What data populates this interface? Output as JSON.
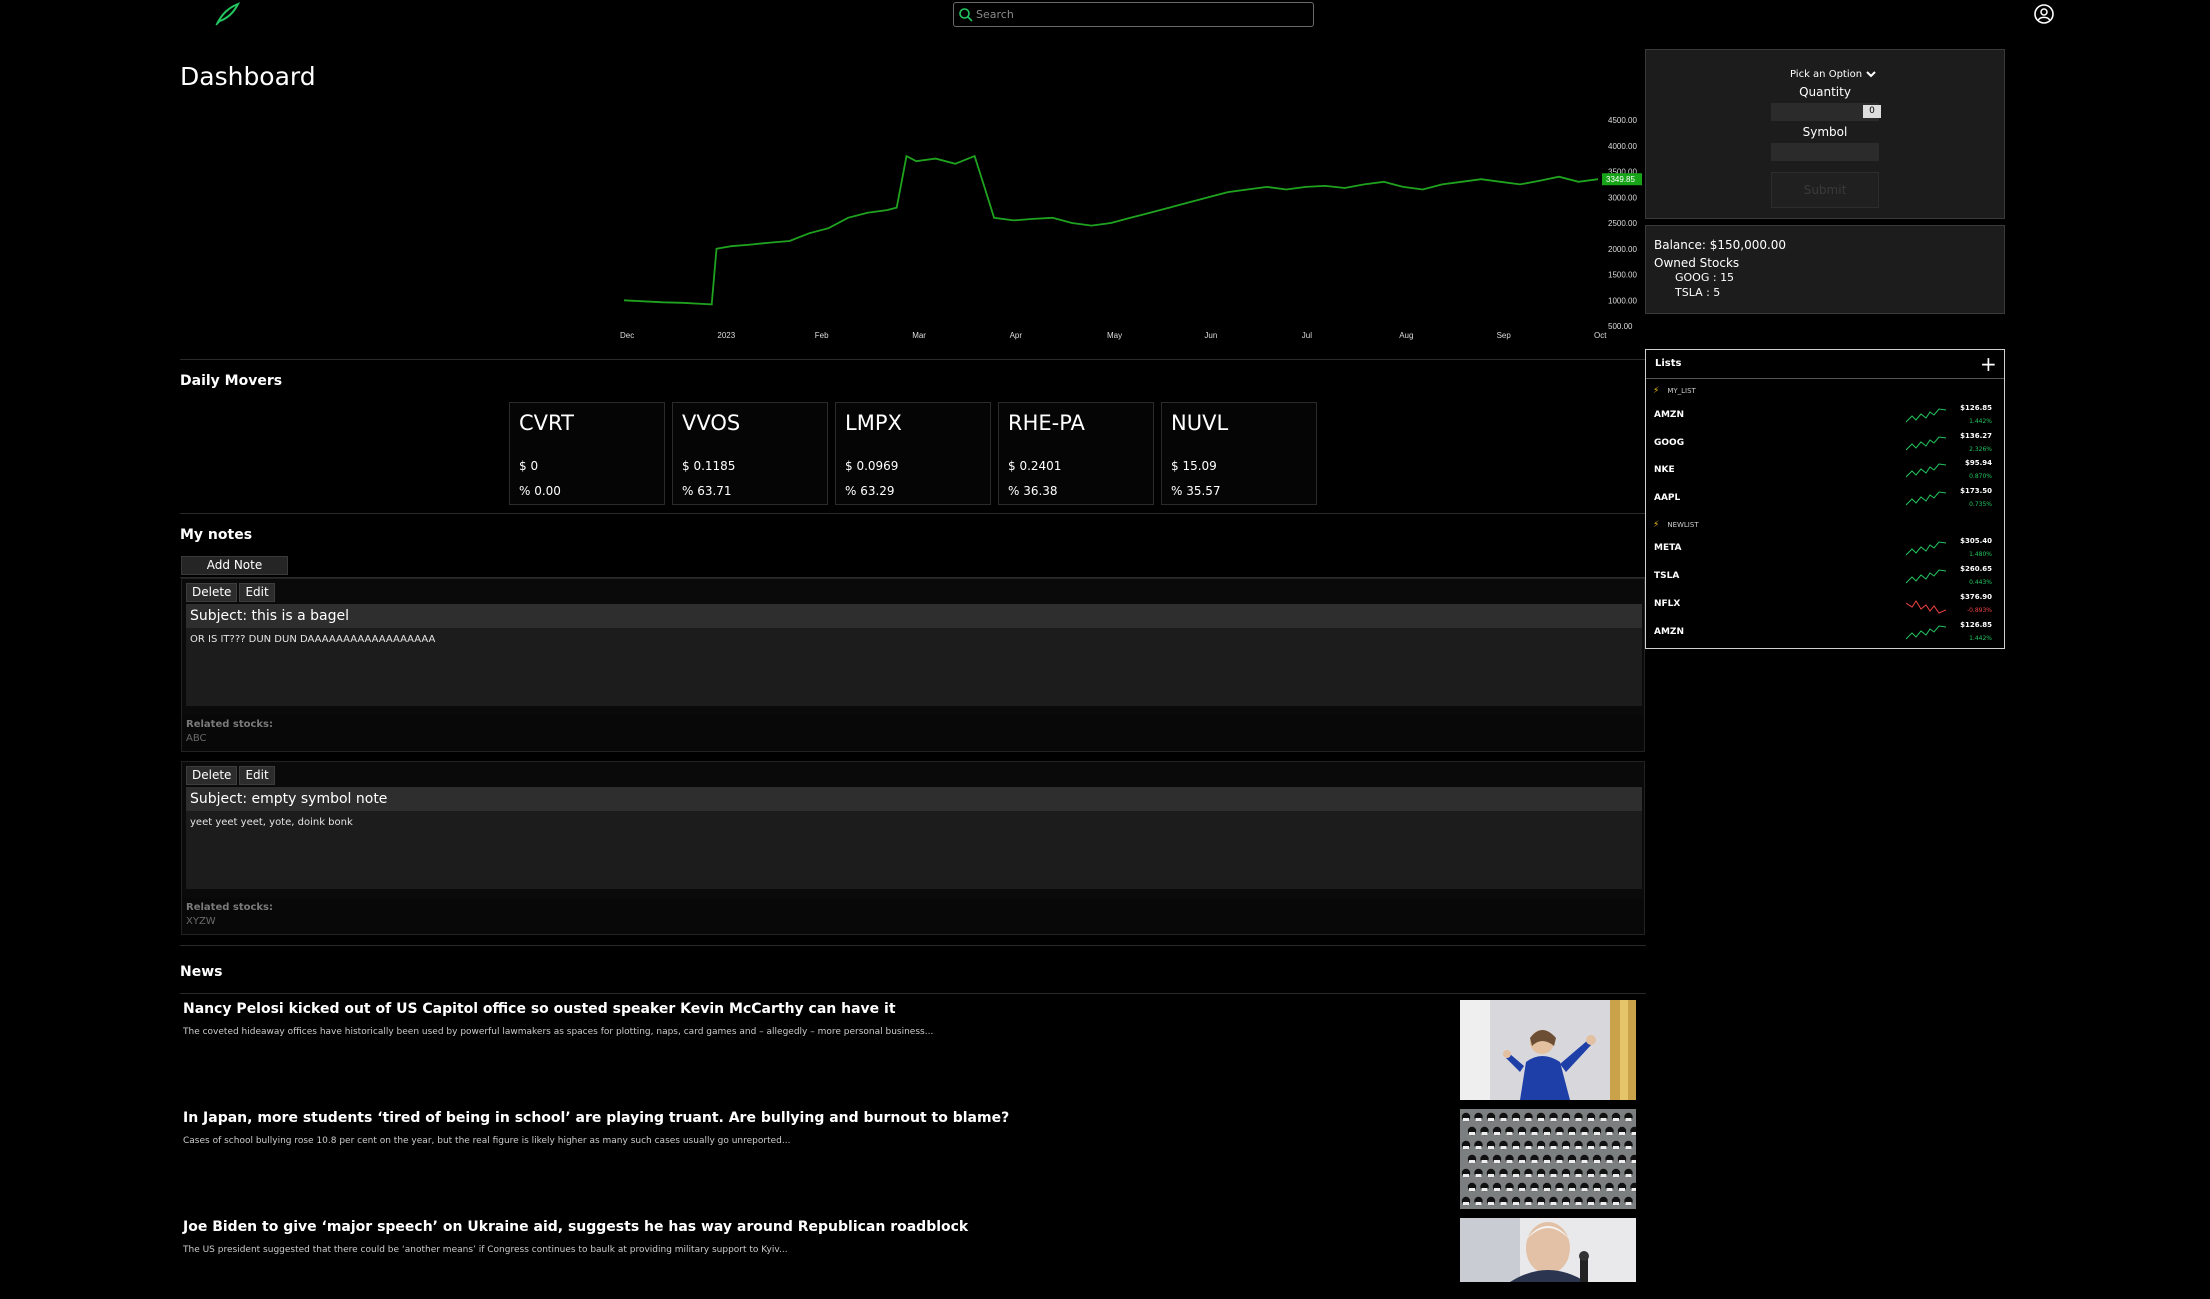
{
  "app": {
    "search_placeholder": "Search",
    "colors": {
      "accent": "#22c55e",
      "down": "#ef4444",
      "background": "#000000"
    }
  },
  "page": {
    "title": "Dashboard"
  },
  "chart_data": {
    "type": "line",
    "title": "",
    "xlabel": "",
    "ylabel": "",
    "x_tick_labels": [
      "Dec",
      "2023",
      "Feb",
      "Mar",
      "Apr",
      "May",
      "Jun",
      "Jul",
      "Aug",
      "Sep",
      "Oct"
    ],
    "y_tick_labels": [
      "4500.00",
      "4000.00",
      "3500.00",
      "3000.00",
      "2500.00",
      "2000.00",
      "1500.00",
      "1000.00",
      "500.00"
    ],
    "ylim": [
      500,
      4500
    ],
    "current_value_label": "3349.85",
    "grid": false,
    "series": [
      {
        "values": [
          [
            0,
            1000
          ],
          [
            2,
            980
          ],
          [
            4,
            960
          ],
          [
            6,
            950
          ],
          [
            8,
            930
          ],
          [
            9,
            920
          ],
          [
            9.5,
            2000
          ],
          [
            11,
            2050
          ],
          [
            13,
            2080
          ],
          [
            15,
            2120
          ],
          [
            17,
            2150
          ],
          [
            19,
            2300
          ],
          [
            21,
            2400
          ],
          [
            23,
            2600
          ],
          [
            25,
            2700
          ],
          [
            27,
            2750
          ],
          [
            28,
            2800
          ],
          [
            29,
            3800
          ],
          [
            30,
            3700
          ],
          [
            32,
            3750
          ],
          [
            34,
            3650
          ],
          [
            36,
            3800
          ],
          [
            37,
            3200
          ],
          [
            38,
            2600
          ],
          [
            40,
            2550
          ],
          [
            42,
            2580
          ],
          [
            44,
            2600
          ],
          [
            46,
            2500
          ],
          [
            48,
            2450
          ],
          [
            50,
            2500
          ],
          [
            52,
            2600
          ],
          [
            54,
            2700
          ],
          [
            56,
            2800
          ],
          [
            58,
            2900
          ],
          [
            60,
            3000
          ],
          [
            62,
            3100
          ],
          [
            64,
            3150
          ],
          [
            66,
            3200
          ],
          [
            68,
            3150
          ],
          [
            70,
            3200
          ],
          [
            72,
            3220
          ],
          [
            74,
            3180
          ],
          [
            76,
            3250
          ],
          [
            78,
            3300
          ],
          [
            80,
            3200
          ],
          [
            82,
            3150
          ],
          [
            84,
            3250
          ],
          [
            86,
            3300
          ],
          [
            88,
            3350
          ],
          [
            90,
            3300
          ],
          [
            92,
            3250
          ],
          [
            94,
            3320
          ],
          [
            96,
            3400
          ],
          [
            98,
            3300
          ],
          [
            100,
            3349.85
          ]
        ]
      }
    ]
  },
  "movers": {
    "title": "Daily Movers",
    "items": [
      {
        "symbol": "CVRT",
        "price": "$ 0",
        "pct": "% 0.00"
      },
      {
        "symbol": "VVOS",
        "price": "$ 0.1185",
        "pct": "% 63.71"
      },
      {
        "symbol": "LMPX",
        "price": "$ 0.0969",
        "pct": "% 63.29"
      },
      {
        "symbol": "RHE-PA",
        "price": "$ 0.2401",
        "pct": "% 36.38"
      },
      {
        "symbol": "NUVL",
        "price": "$ 15.09",
        "pct": "% 35.57"
      }
    ]
  },
  "notes": {
    "title": "My notes",
    "add_label": "Add Note",
    "delete_label": "Delete",
    "edit_label": "Edit",
    "related_label": "Related stocks:",
    "items": [
      {
        "subject": "Subject: this is a bagel",
        "body": "OR IS IT??? DUN DUN DAAAAAAAAAAAAAAAAAA",
        "related": "ABC"
      },
      {
        "subject": "Subject: empty symbol note",
        "body": "yeet yeet yeet, yote, doink bonk",
        "related": "XYZW"
      }
    ]
  },
  "news": {
    "title": "News",
    "items": [
      {
        "headline": "Nancy Pelosi kicked out of US Capitol office so ousted speaker Kevin McCarthy can have it",
        "summary": "The coveted hideaway offices have historically been used by powerful lawmakers as spaces for plotting, naps, card games and – allegedly – more personal business...",
        "image": "pelosi-photo"
      },
      {
        "headline": "In Japan, more students ‘tired of being in school’ are playing truant. Are bullying and burnout to blame?",
        "summary": "Cases of school bullying rose 10.8 per cent on the year, but the real figure is likely higher as many such cases usually go unreported...",
        "image": "students-photo"
      },
      {
        "headline": "Joe Biden to give ‘major speech’ on Ukraine aid, suggests he has way around Republican roadblock",
        "summary": "The US president suggested that there could be ‘another means’ if Congress continues to baulk at providing military support to Kyiv...",
        "image": "biden-photo"
      }
    ]
  },
  "order": {
    "select_label": "Pick an Option",
    "quantity_label": "Quantity",
    "quantity_value": "0",
    "symbol_label": "Symbol",
    "submit_label": "Submit"
  },
  "account": {
    "balance": "Balance: $150,000.00",
    "owned_label": "Owned Stocks",
    "holdings": [
      "GOOG : 15",
      "TSLA : 5"
    ]
  },
  "lists": {
    "title": "Lists",
    "add_icon": "plus-icon",
    "groups": [
      {
        "name": "MY_LIST",
        "stocks": [
          {
            "ticker": "AMZN",
            "price": "$126.85",
            "change": "1.442%",
            "trend": "up"
          },
          {
            "ticker": "GOOG",
            "price": "$136.27",
            "change": "2.326%",
            "trend": "up"
          },
          {
            "ticker": "NKE",
            "price": "$95.94",
            "change": "0.870%",
            "trend": "up"
          },
          {
            "ticker": "AAPL",
            "price": "$173.50",
            "change": "0.735%",
            "trend": "up"
          }
        ]
      },
      {
        "name": "NEWLIST",
        "stocks": [
          {
            "ticker": "META",
            "price": "$305.40",
            "change": "1.480%",
            "trend": "up"
          },
          {
            "ticker": "TSLA",
            "price": "$260.65",
            "change": "0.443%",
            "trend": "up"
          },
          {
            "ticker": "NFLX",
            "price": "$376.90",
            "change": "-0.893%",
            "trend": "down"
          },
          {
            "ticker": "AMZN",
            "price": "$126.85",
            "change": "1.442%",
            "trend": "up"
          }
        ]
      }
    ]
  }
}
